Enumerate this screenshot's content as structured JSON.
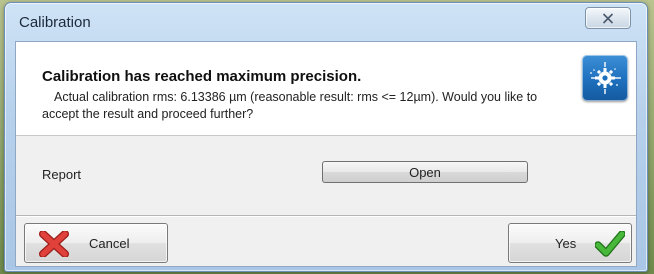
{
  "window": {
    "title": "Calibration"
  },
  "header": {
    "heading": "Calibration has reached maximum precision.",
    "message": "Actual calibration rms: 6.13386 µm (reasonable result: rms <= 12µm). Would you like to accept the result and proceed further?",
    "icon": "calibration-app-icon"
  },
  "report": {
    "label": "Report",
    "open_button": "Open"
  },
  "footer": {
    "cancel_button": "Cancel",
    "yes_button": "Yes"
  },
  "icons": {
    "close": "close-icon",
    "cancel": "red-x-icon",
    "yes": "green-check-icon"
  },
  "colors": {
    "accent": "#1e6fbd",
    "cancel_icon": "#d9342b",
    "yes_icon": "#3aa32c"
  }
}
